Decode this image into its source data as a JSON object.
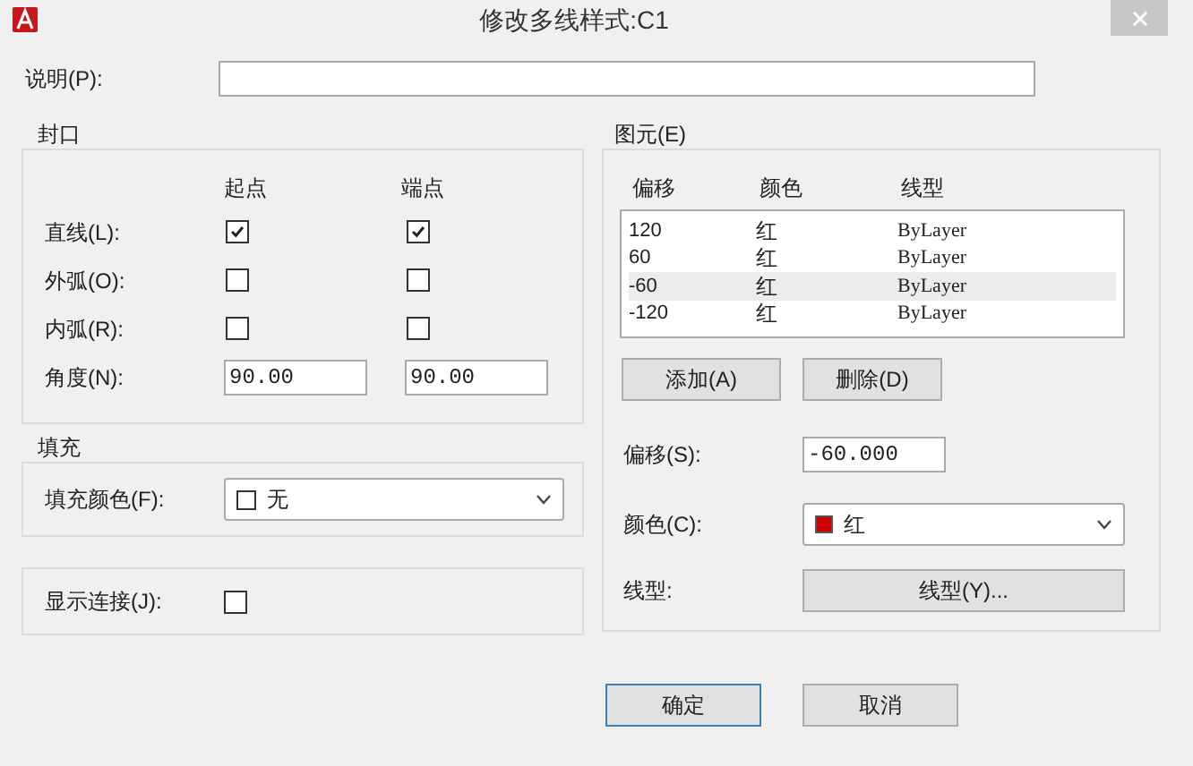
{
  "window": {
    "title": "修改多线样式:C1"
  },
  "description": {
    "label": "说明(P):"
  },
  "caps": {
    "title": "封口",
    "columns": [
      "起点",
      "端点"
    ],
    "rows": [
      {
        "label": "直线(L):",
        "kind": "checkbox",
        "start_checked": true,
        "end_checked": true
      },
      {
        "label": "外弧(O):",
        "kind": "checkbox",
        "start_checked": false,
        "end_checked": false
      },
      {
        "label": "内弧(R):",
        "kind": "checkbox",
        "start_checked": false,
        "end_checked": false
      },
      {
        "label": "角度(N):",
        "kind": "input",
        "start_value": "90.00",
        "end_value": "90.00"
      }
    ]
  },
  "fill": {
    "title": "填充",
    "label": "填充颜色(F):",
    "value": "无"
  },
  "display_joints": {
    "label": "显示连接(J):",
    "checked": false
  },
  "elements": {
    "title": "图元(E)",
    "columns": [
      "偏移",
      "颜色",
      "线型"
    ],
    "rows": [
      {
        "cells": [
          "120",
          "红",
          "ByLayer"
        ],
        "selected": false
      },
      {
        "cells": [
          "60",
          "红",
          "ByLayer"
        ],
        "selected": false
      },
      {
        "cells": [
          "-60",
          "红",
          "ByLayer"
        ],
        "selected": true
      },
      {
        "cells": [
          "-120",
          "红",
          "ByLayer"
        ],
        "selected": false
      }
    ],
    "buttons": [
      "添加(A)",
      "删除(D)"
    ],
    "offset": {
      "label": "偏移(S):",
      "value": "-60.000"
    },
    "color": {
      "label": "颜色(C):",
      "value": "红"
    },
    "linetype": {
      "label": "线型:",
      "button": "线型(Y)..."
    }
  },
  "buttons": [
    {
      "label": "确定",
      "default": true
    },
    {
      "label": "取消",
      "default": false
    }
  ]
}
